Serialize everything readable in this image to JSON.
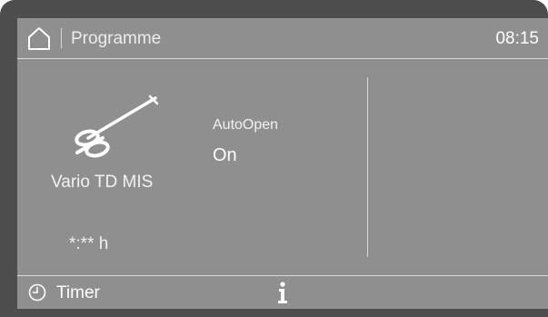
{
  "header": {
    "home_icon": "home-icon",
    "title": "Programme",
    "time": "08:15"
  },
  "program": {
    "icon": "surgical-instrument-icon",
    "name": "Vario TD MIS",
    "duration": "*:** h"
  },
  "option": {
    "label": "AutoOpen",
    "value": "On"
  },
  "footer": {
    "timer_icon": "clock-icon",
    "timer_label": "Timer",
    "info_icon": "info-icon"
  },
  "colors": {
    "bezel": "#4d4d4d",
    "screen": "#8f8f8f",
    "text": "#ffffff",
    "lines": "#d9d9d9"
  }
}
